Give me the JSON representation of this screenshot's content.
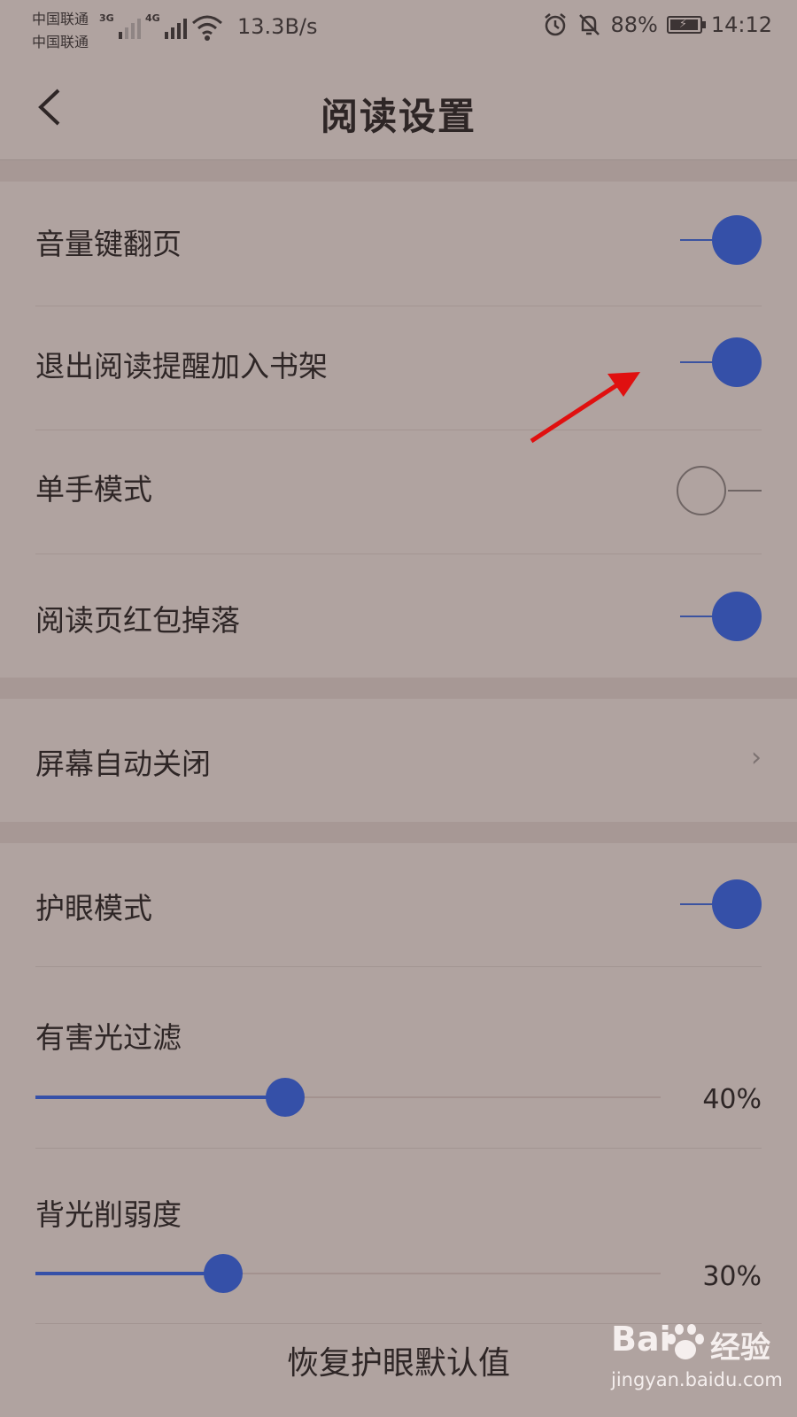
{
  "statusbar": {
    "carrier1": "中国联通",
    "carrier2": "中国联通",
    "net1": "3G",
    "net2": "4G",
    "speed": "13.3B/s",
    "battery": "88%",
    "time": "14:12"
  },
  "header": {
    "title": "阅读设置",
    "back_icon": "chevron-left-icon"
  },
  "section1": [
    {
      "label": "音量键翻页",
      "on": true
    },
    {
      "label": "退出阅读提醒加入书架",
      "on": true
    },
    {
      "label": "单手模式",
      "on": false
    },
    {
      "label": "阅读页红包掉落",
      "on": true
    }
  ],
  "screen_off": {
    "label": "屏幕自动关闭",
    "icon": "chevron-right-icon"
  },
  "eye_mode": {
    "label": "护眼模式",
    "on": true
  },
  "filter": {
    "label": "有害光过滤",
    "value_text": "40%",
    "value": 0.4
  },
  "backlight": {
    "label": "背光削弱度",
    "value_text": "30%",
    "value": 0.3
  },
  "reset_label": "恢复护眼默认值",
  "watermark": {
    "brand": "Bai",
    "brand_cn": "经验",
    "url": "jingyan.baidu.com"
  },
  "colors": {
    "accent": "#3550a8",
    "background": "#b0a3a0",
    "annotation_arrow": "#e01010"
  }
}
